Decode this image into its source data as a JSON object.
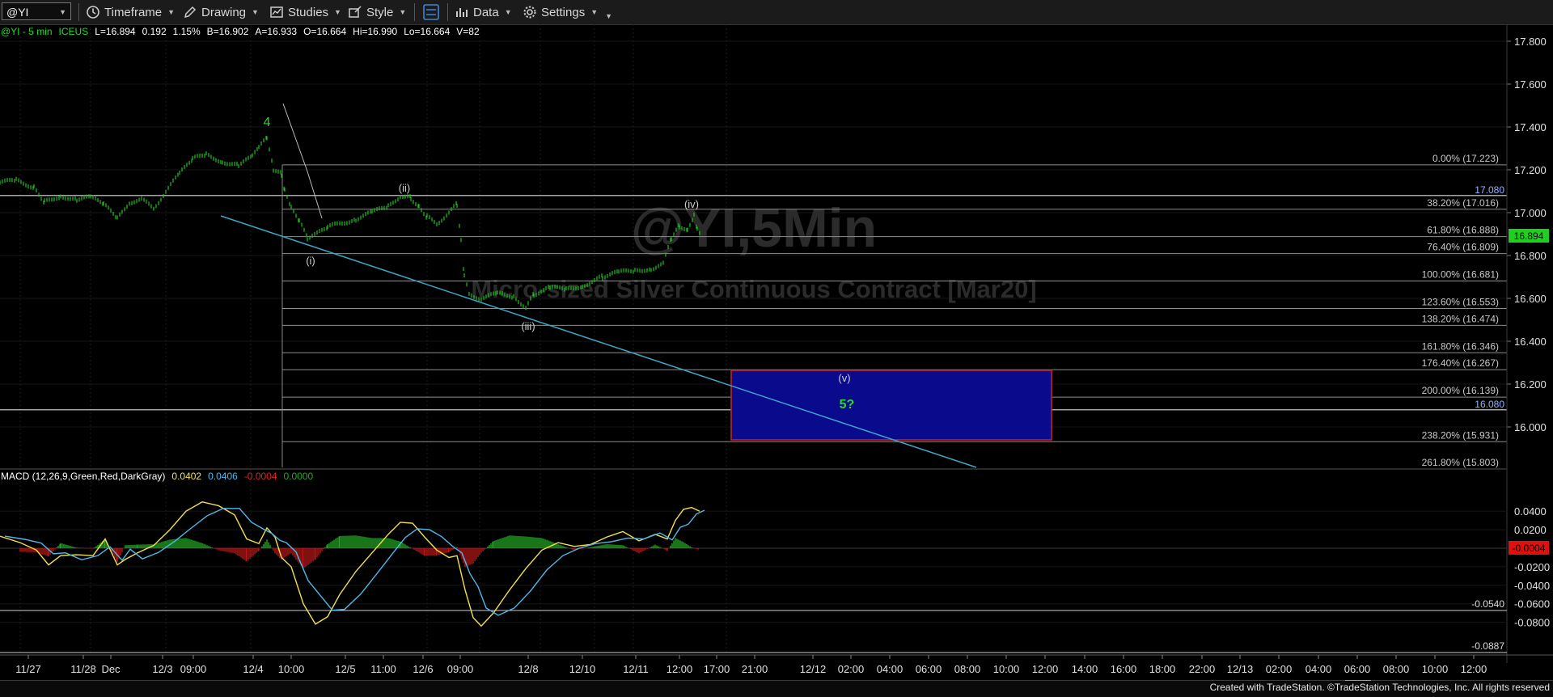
{
  "toolbar": {
    "symbol": "@YI",
    "timeframe": "Timeframe",
    "drawing": "Drawing",
    "studies": "Studies",
    "style": "Style",
    "data": "Data",
    "settings": "Settings"
  },
  "status": {
    "prefix": "@YI - 5 min",
    "exchange": "ICEUS",
    "last": "L=16.894",
    "change": "0.192",
    "pct": "1.15%",
    "bid": "B=16.902",
    "ask": "A=16.933",
    "open": "O=16.664",
    "high": "Hi=16.990",
    "low": "Lo=16.664",
    "volume": "V=82"
  },
  "watermark": {
    "symbol": "@YI,5Min",
    "description": "Micro-sized Silver Continuous Contract [Mar20]"
  },
  "price_axis": {
    "labels": [
      "17.800",
      "17.600",
      "17.400",
      "17.200",
      "17.000",
      "16.800",
      "16.600",
      "16.400",
      "16.200",
      "16.000"
    ],
    "current_price": "16.894",
    "hline_top_label": "17.080",
    "hline_bottom_label": "16.080"
  },
  "fibonacci": [
    {
      "label": "0.00% (17.223)",
      "price": 17.223
    },
    {
      "label": "38.20% (17.016)",
      "price": 17.016
    },
    {
      "label": "61.80% (16.888)",
      "price": 16.888
    },
    {
      "label": "76.40% (16.809)",
      "price": 16.809
    },
    {
      "label": "100.00% (16.681)",
      "price": 16.681
    },
    {
      "label": "123.60% (16.553)",
      "price": 16.553
    },
    {
      "label": "138.20% (16.474)",
      "price": 16.474
    },
    {
      "label": "161.80% (16.346)",
      "price": 16.346
    },
    {
      "label": "176.40% (16.267)",
      "price": 16.267
    },
    {
      "label": "200.00% (16.139)",
      "price": 16.139
    },
    {
      "label": "238.20% (15.931)",
      "price": 15.931
    },
    {
      "label": "261.80% (15.803)",
      "price": 15.803
    }
  ],
  "wave_labels": {
    "w4": "4",
    "wi": "(i)",
    "wii": "(ii)",
    "wiii": "(iii)",
    "wiv": "(iv)",
    "wv": "(v)",
    "w5": "5?"
  },
  "macd": {
    "title": "MACD (12,26,9,Green,Red,DarkGray)",
    "v1": "0.0402",
    "v2": "0.0406",
    "v3": "-0.0004",
    "v4": "0.0000",
    "axis_labels": [
      "0.0400",
      "0.0200",
      "-0.0200",
      "-0.0400",
      "-0.0600",
      "-0.0800"
    ],
    "current": "-0.0004",
    "hline_a": "-0.0540",
    "hline_b": "-0.0887"
  },
  "time_axis": [
    "11/27",
    "11/28",
    "Dec",
    "12/3",
    "09:00",
    "12/4",
    "10:00",
    "12/5",
    "11:00",
    "12/6",
    "09:00",
    "12/8",
    "12/10",
    "12/11",
    "12:00",
    "17:00",
    "21:00",
    "12/12",
    "02:00",
    "04:00",
    "06:00",
    "08:00",
    "10:00",
    "12:00",
    "14:00",
    "16:00",
    "18:00",
    "22:00",
    "12/13",
    "02:00",
    "04:00",
    "06:00",
    "08:00",
    "10:00",
    "12:00"
  ],
  "footer": "Created with TradeStation. ©TradeStation Technologies, Inc. All rights reserved",
  "colors": {
    "background": "#000000",
    "price_bars": "#22c222",
    "trendline": "#3aa6c8",
    "target_box": "#0a0a8c",
    "target_border": "#cc2222",
    "current_price_tag": "#1fcf1f",
    "macd_tag": "#e01010"
  }
}
